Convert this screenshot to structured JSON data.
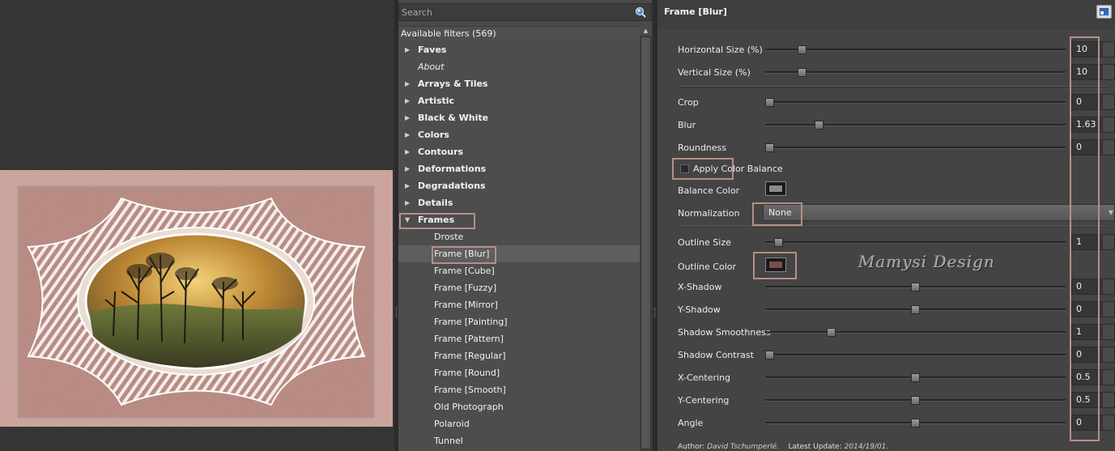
{
  "search": {
    "placeholder": "Search"
  },
  "tree": {
    "header": "Available filters (569)",
    "categories": [
      {
        "label": "Faves",
        "italic": false
      },
      {
        "label": "About",
        "italic": true
      },
      {
        "label": "Arrays & Tiles",
        "italic": false
      },
      {
        "label": "Artistic",
        "italic": false
      },
      {
        "label": "Black & White",
        "italic": false
      },
      {
        "label": "Colors",
        "italic": false
      },
      {
        "label": "Contours",
        "italic": false
      },
      {
        "label": "Deformations",
        "italic": false
      },
      {
        "label": "Degradations",
        "italic": false
      },
      {
        "label": "Details",
        "italic": false
      }
    ],
    "open_category": "Frames",
    "children": [
      "Droste",
      "Frame [Blur]",
      "Frame [Cube]",
      "Frame [Fuzzy]",
      "Frame [Mirror]",
      "Frame [Painting]",
      "Frame [Pattern]",
      "Frame [Regular]",
      "Frame [Round]",
      "Frame [Smooth]",
      "Old Photograph",
      "Polaroid",
      "Tunnel"
    ],
    "selected_child": "Frame [Blur]"
  },
  "filter": {
    "title": "Frame [Blur]",
    "params": [
      {
        "label": "Horizontal Size (%)",
        "value": "10",
        "level": 0.11
      },
      {
        "label": "Vertical Size (%)",
        "value": "10",
        "level": 0.11
      },
      {
        "label": "Crop",
        "value": "0",
        "level": 0.0
      },
      {
        "label": "Blur",
        "value": "1.63",
        "level": 0.17
      },
      {
        "label": "Roundness",
        "value": "0",
        "level": 0.0
      },
      {
        "label": "Outline Size",
        "value": "1",
        "level": 0.03
      },
      {
        "label": "X-Shadow",
        "value": "0",
        "level": 0.5
      },
      {
        "label": "Y-Shadow",
        "value": "0",
        "level": 0.5
      },
      {
        "label": "Shadow Smoothness",
        "value": "1",
        "level": 0.21
      },
      {
        "label": "Shadow Contrast",
        "value": "0",
        "level": 0.0
      },
      {
        "label": "X-Centering",
        "value": "0.5",
        "level": 0.5
      },
      {
        "label": "Y-Centering",
        "value": "0.5",
        "level": 0.5
      },
      {
        "label": "Angle",
        "value": "0",
        "level": 0.5
      }
    ],
    "apply_color_balance": {
      "label": "Apply Color Balance",
      "checked": false
    },
    "balance_color": {
      "label": "Balance Color",
      "color": "#8a8a8a"
    },
    "normalization": {
      "label": "Normalization",
      "value": "None"
    },
    "outline_color": {
      "label": "Outline Color",
      "color": "#7a4f52"
    }
  },
  "footer": {
    "author_label": "Author:",
    "author": "David Tschumperlé.",
    "update_label": "Latest Update:",
    "update": "2014/19/01."
  },
  "watermark": "Mamysi Design",
  "colors": {
    "highlight": "#b98d86",
    "frame_rose": "#c49890"
  }
}
